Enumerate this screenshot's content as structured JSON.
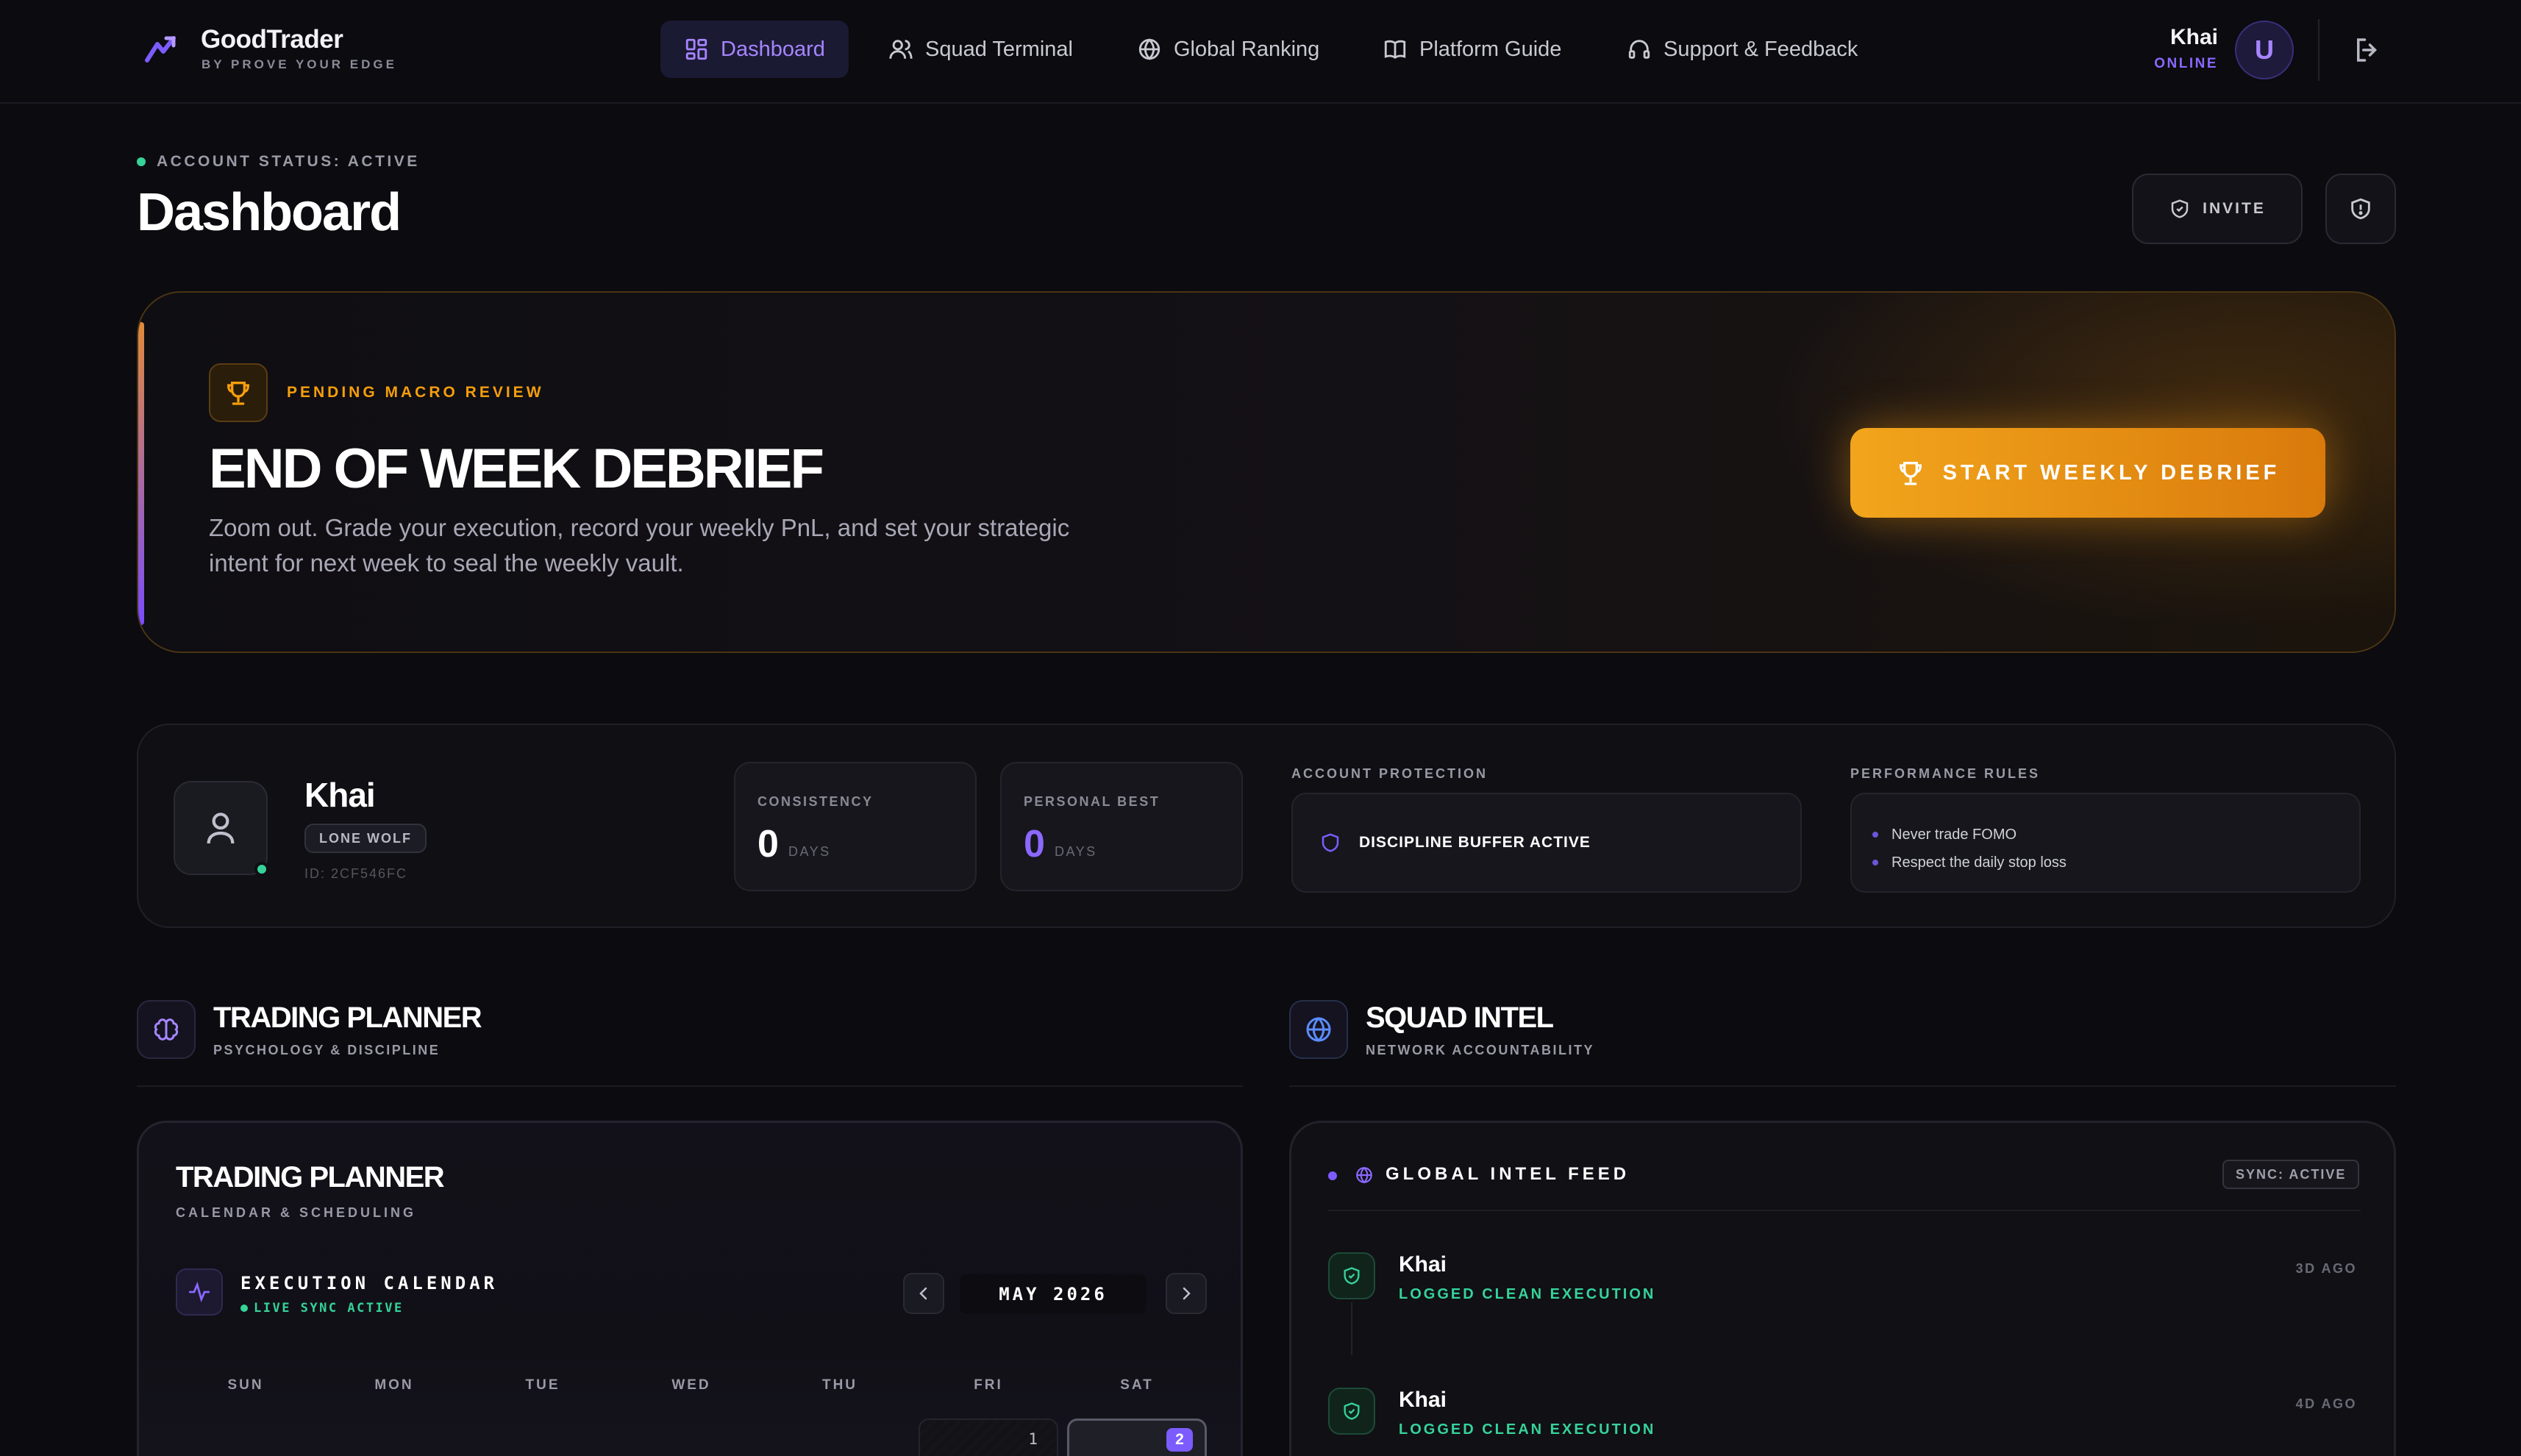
{
  "header": {
    "brand_name": "GoodTrader",
    "brand_tagline": "BY PROVE YOUR EDGE",
    "nav": [
      {
        "label": "Dashboard",
        "icon": "grid-icon",
        "active": true
      },
      {
        "label": "Squad Terminal",
        "icon": "users-icon",
        "active": false
      },
      {
        "label": "Global Ranking",
        "icon": "globe-icon",
        "active": false
      },
      {
        "label": "Platform Guide",
        "icon": "book-icon",
        "active": false
      },
      {
        "label": "Support & Feedback",
        "icon": "headset-icon",
        "active": false
      }
    ],
    "user_name": "Khai",
    "user_status": "ONLINE",
    "avatar_initial": "U"
  },
  "page": {
    "status": "ACCOUNT STATUS: ACTIVE",
    "title": "Dashboard",
    "invite_label": "INVITE"
  },
  "banner": {
    "label": "PENDING MACRO REVIEW",
    "title": "END OF WEEK DEBRIEF",
    "description": "Zoom out. Grade your execution, record your weekly PnL, and set your strategic intent for next week to seal the weekly vault.",
    "button_label": "START WEEKLY DEBRIEF"
  },
  "profile": {
    "name": "Khai",
    "badge": "LONE WOLF",
    "id": "ID: 2CF546FC",
    "consistency_label": "CONSISTENCY",
    "consistency_value": "0",
    "consistency_unit": "DAYS",
    "best_label": "PERSONAL BEST",
    "best_value": "0",
    "best_unit": "DAYS",
    "protection_label": "ACCOUNT PROTECTION",
    "protection_status": "DISCIPLINE BUFFER ACTIVE",
    "rules_label": "PERFORMANCE RULES",
    "rules": [
      "Never trade FOMO",
      "Respect the daily stop loss"
    ]
  },
  "sections": {
    "planner_title": "TRADING PLANNER",
    "planner_sub": "PSYCHOLOGY & DISCIPLINE",
    "intel_title": "SQUAD INTEL",
    "intel_sub": "NETWORK ACCOUNTABILITY"
  },
  "planner": {
    "title": "TRADING PLANNER",
    "subtitle": "CALENDAR & SCHEDULING",
    "calendar_title": "EXECUTION CALENDAR",
    "calendar_status": "LIVE SYNC ACTIVE",
    "month": "MAY 2026",
    "weekdays": [
      "SUN",
      "MON",
      "TUE",
      "WED",
      "THU",
      "FRI",
      "SAT"
    ],
    "days": [
      "1",
      "2"
    ]
  },
  "intel": {
    "feed_title": "GLOBAL INTEL FEED",
    "sync_badge": "SYNC: ACTIVE",
    "feed": [
      {
        "name": "Khai",
        "action": "LOGGED CLEAN EXECUTION",
        "time": "3D AGO"
      },
      {
        "name": "Khai",
        "action": "LOGGED CLEAN EXECUTION",
        "time": "4D AGO"
      }
    ]
  },
  "colors": {
    "accent": "#7c5cff",
    "warning": "#f59e0b",
    "success": "#36d399",
    "background": "#0b0b10"
  }
}
